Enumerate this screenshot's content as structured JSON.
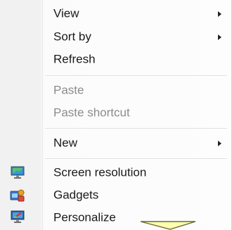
{
  "menu": {
    "items": [
      {
        "label": "View",
        "has_submenu": true
      },
      {
        "label": "Sort by",
        "has_submenu": true
      },
      {
        "label": "Refresh",
        "has_submenu": false
      },
      {
        "label": "Paste",
        "disabled": true
      },
      {
        "label": "Paste shortcut",
        "disabled": true
      },
      {
        "label": "New",
        "has_submenu": true
      },
      {
        "label": "Screen resolution",
        "icon": "monitor-icon"
      },
      {
        "label": "Gadgets",
        "icon": "gadgets-icon"
      },
      {
        "label": "Personalize",
        "icon": "personalize-icon"
      }
    ]
  },
  "colors": {
    "text": "#1a1a1a",
    "disabled_text": "#8c8c8c",
    "cursor_fill": "#ffffb0"
  }
}
